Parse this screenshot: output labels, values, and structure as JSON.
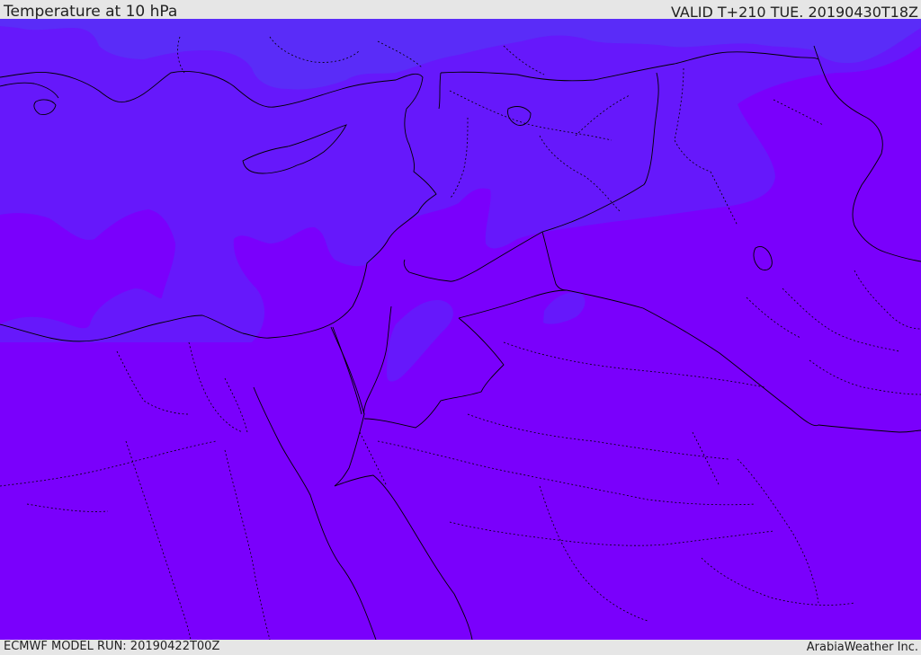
{
  "header": {
    "title": "Temperature at 10 hPa",
    "valid": "VALID T+210 TUE. 20190430T18Z"
  },
  "footer": {
    "model_run": "ECMWF MODEL RUN: 20190422T00Z",
    "credit": "ArabiaWeather Inc."
  },
  "colors": {
    "background": "#7a00fc",
    "cool_zone": "#6618fb",
    "cooler_zone": "#5a2cf8",
    "border": "#000000",
    "frame": "#e6e6e6"
  }
}
